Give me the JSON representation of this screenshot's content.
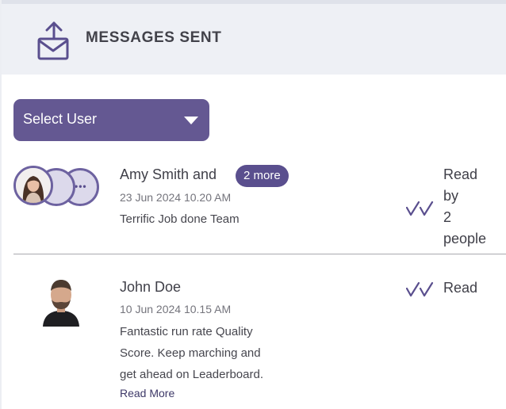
{
  "header": {
    "title": "MESSAGES SENT",
    "icon": "outbox-envelope-icon"
  },
  "select_user": {
    "label": "Select User"
  },
  "messages": [
    {
      "sender": "Amy Smith and",
      "more_badge": "2 more",
      "date": "23 Jun 2024 10.20 AM",
      "text": "Terrific Job done Team",
      "status": [
        "Read",
        "by",
        "2",
        "people"
      ]
    },
    {
      "sender": "John Doe",
      "date": "10 Jun 2024 10.15 AM",
      "text": [
        "Fantastic run rate Quality",
        "Score. Keep marching and",
        "get ahead on Leaderboard."
      ],
      "read_more": "Read More",
      "status": [
        "Read"
      ]
    }
  ],
  "colors": {
    "accent": "#645892",
    "header_bg": "#eef0f5",
    "badge": "#5a4f8e"
  }
}
